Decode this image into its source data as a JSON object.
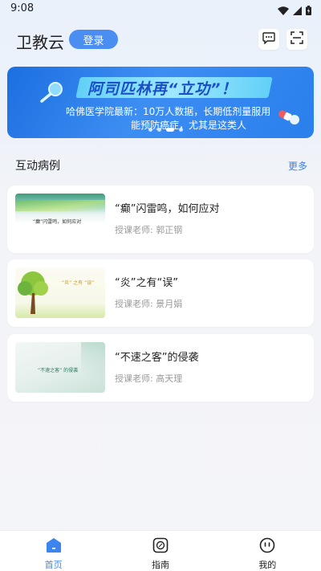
{
  "status_bar": {
    "time": "9:08",
    "icons": [
      "wifi-icon",
      "signal-icon",
      "battery-icon"
    ]
  },
  "header": {
    "title": "卫教云",
    "login_label": "登录",
    "icons": [
      "message-icon",
      "scan-icon"
    ]
  },
  "banner": {
    "title": "阿司匹林再“立功”！",
    "line1": "哈佛医学院最新：10万人数据，长期低剂量服用",
    "line2": "能预防癌症，尤其是这类人",
    "dot_count": 4,
    "active_dot": 2
  },
  "section": {
    "title": "互动病例",
    "more_label": "更多"
  },
  "cases": [
    {
      "title": "“癫”闪雷鸣，如何应对",
      "teacher": "授课老师: 郭正钢",
      "thumb_text": "“癫”闪雷鸣，如何应对"
    },
    {
      "title": "“炎”之有“误”",
      "teacher": "授课老师: 景月娟",
      "thumb_text": "“炎” 之有 “误”"
    },
    {
      "title": "“不速之客”的侵袭",
      "teacher": "授课老师: 高天理",
      "thumb_text": "“不速之客” 的侵袭"
    }
  ],
  "tabbar": {
    "items": [
      {
        "label": "首页",
        "icon": "home-icon",
        "active": true
      },
      {
        "label": "指南",
        "icon": "compass-icon",
        "active": false
      },
      {
        "label": "我的",
        "icon": "profile-icon",
        "active": false
      }
    ]
  },
  "colors": {
    "accent": "#4a8ef2",
    "tab_active": "#3d85ee",
    "muted_text": "#9a9a9a"
  }
}
